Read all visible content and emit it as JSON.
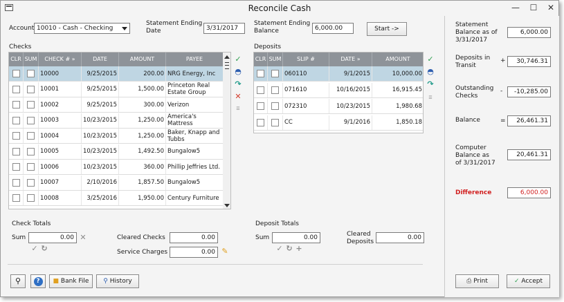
{
  "window": {
    "title": "Reconcile Cash"
  },
  "header": {
    "account_label": "Account",
    "account_value": "10010 - Cash - Checking",
    "stmt_end_date_label_1": "Statement Ending",
    "stmt_end_date_label_2": "Date",
    "stmt_end_date_value": "3/31/2017",
    "stmt_end_bal_label_1": "Statement Ending",
    "stmt_end_bal_label_2": "Balance",
    "stmt_end_bal_value": "6,000.00",
    "start_button": "Start ->"
  },
  "checks": {
    "section_label": "Checks",
    "columns": [
      "CLR",
      "SUM",
      "CHECK # »",
      "DATE",
      "AMOUNT",
      "PAYEE"
    ],
    "rows": [
      {
        "check": "10000",
        "date": "9/25/2015",
        "amount": "200.00",
        "payee": "NRG Energy, Inc"
      },
      {
        "check": "10001",
        "date": "9/25/2015",
        "amount": "1,500.00",
        "payee": "Princeton Real Estate Group"
      },
      {
        "check": "10002",
        "date": "9/25/2015",
        "amount": "300.00",
        "payee": "Verizon"
      },
      {
        "check": "10003",
        "date": "10/23/2015",
        "amount": "1,250.00",
        "payee": "America's Mattress"
      },
      {
        "check": "10004",
        "date": "10/23/2015",
        "amount": "1,250.00",
        "payee": "Baker, Knapp and Tubbs"
      },
      {
        "check": "10005",
        "date": "10/23/2015",
        "amount": "1,492.50",
        "payee": "Bungalow5"
      },
      {
        "check": "10006",
        "date": "10/23/2015",
        "amount": "360.00",
        "payee": "Phillip Jeffries Ltd."
      },
      {
        "check": "10007",
        "date": "2/10/2016",
        "amount": "1,857.50",
        "payee": "Bungalow5"
      },
      {
        "check": "10008",
        "date": "3/25/2016",
        "amount": "1,950.00",
        "payee": "Century Furniture"
      }
    ]
  },
  "deposits": {
    "section_label": "Deposits",
    "columns": [
      "CLR",
      "SUM",
      "SLIP #",
      "DATE »",
      "AMOUNT"
    ],
    "rows": [
      {
        "slip": "060110",
        "date": "9/1/2015",
        "amount": "10,000.00"
      },
      {
        "slip": "071610",
        "date": "10/16/2015",
        "amount": "16,915.45"
      },
      {
        "slip": "072310",
        "date": "10/23/2015",
        "amount": "1,980.68"
      },
      {
        "slip": "CC",
        "date": "9/1/2016",
        "amount": "1,850.18"
      }
    ]
  },
  "check_totals": {
    "label": "Check Totals",
    "sum_label": "Sum",
    "sum_value": "0.00",
    "cleared_checks_label": "Cleared Checks",
    "cleared_checks_value": "0.00",
    "service_charges_label": "Service Charges",
    "service_charges_value": "0.00"
  },
  "deposit_totals": {
    "label": "Deposit Totals",
    "sum_label": "Sum",
    "sum_value": "0.00",
    "cleared_deposits_label_1": "Cleared",
    "cleared_deposits_label_2": "Deposits",
    "cleared_deposits_value": "0.00"
  },
  "summary": {
    "stmt_balance_label_1": "Statement",
    "stmt_balance_label_2": "Balance as of",
    "stmt_balance_label_3": "3/31/2017",
    "stmt_balance_value": "6,000.00",
    "deposits_transit_label_1": "Deposits in",
    "deposits_transit_label_2": "Transit",
    "deposits_transit_sign": "+",
    "deposits_transit_value": "30,746.31",
    "outstanding_label_1": "Outstanding",
    "outstanding_label_2": "Checks",
    "outstanding_sign": "-",
    "outstanding_value": "-10,285.00",
    "balance_label": "Balance",
    "balance_sign": "=",
    "balance_value": "26,461.31",
    "computer_label_1": "Computer",
    "computer_label_2": "Balance as",
    "computer_label_3": "of 3/31/2017",
    "computer_value": "20,461.31",
    "difference_label": "Difference",
    "difference_value": "6,000.00",
    "difference_color": "#d12020"
  },
  "footer": {
    "bank_file_button": "Bank File",
    "history_button": "History",
    "print_button": "Print",
    "accept_button": "Accept"
  }
}
